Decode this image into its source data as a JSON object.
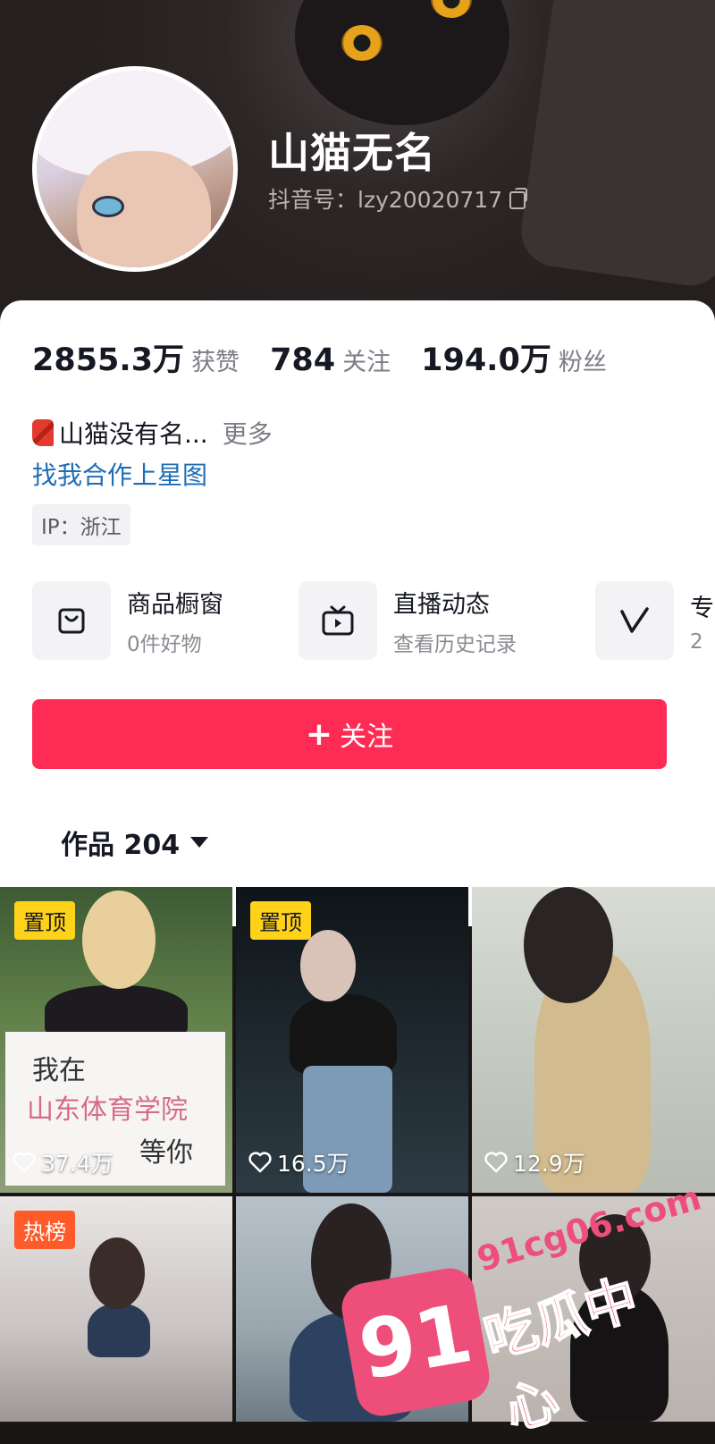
{
  "profile": {
    "name": "山猫无名",
    "douyin_id": "抖音号：lzy20020717"
  },
  "stats": [
    {
      "value": "2855.3万",
      "label": "获赞"
    },
    {
      "value": "784",
      "label": "关注"
    },
    {
      "value": "194.0万",
      "label": "粉丝"
    }
  ],
  "bio": {
    "text": "山猫没有名...",
    "more": "更多",
    "collab_link": "找我合作上星图",
    "ip": "IP：浙江"
  },
  "features": [
    {
      "title": "商品橱窗",
      "subtitle": "0件好物",
      "icon": "shopping-bag-icon"
    },
    {
      "title": "直播动态",
      "subtitle": "查看历史记录",
      "icon": "tv-icon"
    },
    {
      "title": "专",
      "subtitle": "2",
      "icon": "v-icon"
    }
  ],
  "follow_button": {
    "plus": "+",
    "label": "关注"
  },
  "works_tab": {
    "label": "作品 204"
  },
  "grid": [
    {
      "badge": "置顶",
      "likes": "37.4万"
    },
    {
      "badge": "置顶",
      "likes": "16.5万"
    },
    {
      "badge": "",
      "likes": "12.9万"
    },
    {
      "badge": "热榜",
      "likes": ""
    },
    {
      "badge": "",
      "likes": ""
    },
    {
      "badge": "",
      "likes": ""
    }
  ],
  "sign_text": {
    "line1": "我在",
    "line2": "山东体育学院",
    "line3": "等你"
  },
  "watermark": {
    "logo": "91",
    "site": "91cg06.com",
    "name": "吃瓜中心"
  },
  "colors": {
    "accent": "#fe2c55",
    "link": "#1d6db5",
    "pin_badge": "#ffd21a",
    "hot_badge": "#ff5a2a",
    "watermark": "#ee4f7a"
  }
}
